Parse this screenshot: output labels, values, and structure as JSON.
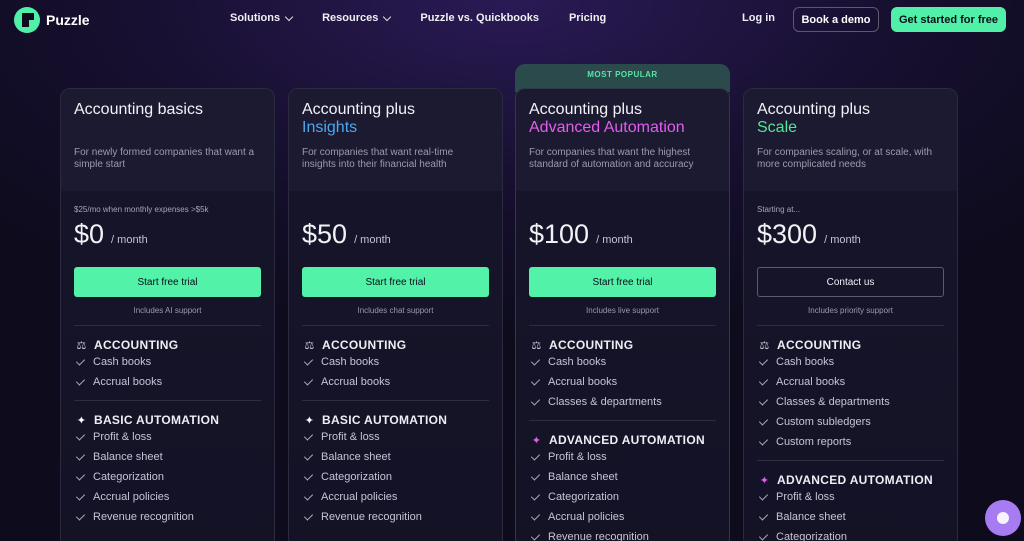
{
  "nav": {
    "brand": "Puzzle",
    "menu": [
      {
        "label": "Solutions",
        "has_dropdown": true
      },
      {
        "label": "Resources",
        "has_dropdown": true
      },
      {
        "label": "Puzzle vs. Quickbooks",
        "has_dropdown": false
      },
      {
        "label": "Pricing",
        "has_dropdown": false
      }
    ],
    "login": "Log in",
    "demo": "Book a demo",
    "start": "Get started for free"
  },
  "popular_badge": "MOST POPULAR",
  "plans": [
    {
      "name": "Accounting basics",
      "tier": "",
      "tier_color": "",
      "description": "For newly formed companies that want a simple start",
      "price_note": "$25/mo when monthly expenses >$5k",
      "price": "$0",
      "per": "/ month",
      "cta": "Start free trial",
      "support": "Includes AI support",
      "sections": [
        {
          "title": "ACCOUNTING",
          "icon": "scale-icon",
          "features": [
            "Cash books",
            "Accrual books"
          ]
        },
        {
          "title": "BASIC AUTOMATION",
          "icon": "sparkle-icon",
          "features": [
            "Profit & loss",
            "Balance sheet",
            "Categorization",
            "Accrual policies",
            "Revenue recognition"
          ]
        }
      ]
    },
    {
      "name": "Accounting plus",
      "tier": "Insights",
      "tier_color": "#4aa8f0",
      "description": "For companies that want real-time insights into their financial health",
      "price_note": "",
      "price": "$50",
      "per": "/ month",
      "cta": "Start free trial",
      "support": "Includes chat support",
      "sections": [
        {
          "title": "ACCOUNTING",
          "icon": "scale-icon",
          "features": [
            "Cash books",
            "Accrual books"
          ]
        },
        {
          "title": "BASIC AUTOMATION",
          "icon": "sparkle-icon",
          "features": [
            "Profit & loss",
            "Balance sheet",
            "Categorization",
            "Accrual policies",
            "Revenue recognition"
          ]
        }
      ]
    },
    {
      "name": "Accounting plus",
      "tier": "Advanced Automation",
      "tier_color": "#e45cf0",
      "description": "For companies that want the highest standard of automation and accuracy",
      "price_note": "",
      "price": "$100",
      "per": "/ month",
      "cta": "Start free trial",
      "support": "Includes live support",
      "sections": [
        {
          "title": "ACCOUNTING",
          "icon": "scale-icon",
          "features": [
            "Cash books",
            "Accrual books",
            "Classes & departments"
          ]
        },
        {
          "title": "ADVANCED AUTOMATION",
          "icon": "pink-sparkle-icon",
          "features": [
            "Profit & loss",
            "Balance sheet",
            "Categorization",
            "Accrual policies",
            "Revenue recognition"
          ]
        }
      ]
    },
    {
      "name": "Accounting plus",
      "tier": "Scale",
      "tier_color": "#52e69a",
      "description": "For companies scaling, or at scale, with more complicated needs",
      "price_note": "Starting at...",
      "price": "$300",
      "per": "/ month",
      "cta": "Contact us",
      "support": "Includes priority support",
      "sections": [
        {
          "title": "ACCOUNTING",
          "icon": "scale-icon",
          "features": [
            "Cash books",
            "Accrual books",
            "Classes & departments",
            "Custom subledgers",
            "Custom reports"
          ]
        },
        {
          "title": "ADVANCED AUTOMATION",
          "icon": "pink-sparkle-icon",
          "features": [
            "Profit & loss",
            "Balance sheet",
            "Categorization"
          ]
        }
      ]
    }
  ]
}
